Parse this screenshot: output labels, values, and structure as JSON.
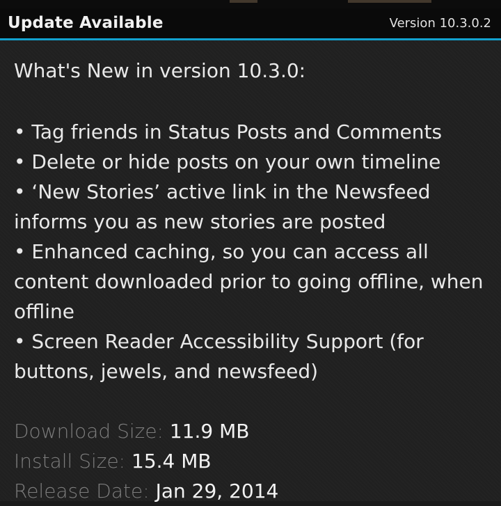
{
  "header": {
    "title": "Update Available",
    "version": "Version 10.3.0.2"
  },
  "release_notes": {
    "heading": "What's New in version 10.3.0:",
    "bullet": "•",
    "items": [
      "Tag friends in Status Posts and Comments",
      "Delete or hide posts on your own timeline",
      "‘New Stories’ active link in the Newsfeed informs you as new stories are posted",
      "Enhanced caching, so you can access all content downloaded prior to going offline, when offline",
      "Screen Reader Accessibility Support (for buttons, jewels, and newsfeed)"
    ]
  },
  "details": {
    "download_size": {
      "label": "Download Size:",
      "value": "11.9 MB"
    },
    "install_size": {
      "label": "Install Size:",
      "value": "15.4 MB"
    },
    "release_date": {
      "label": "Release Date:",
      "value": "Jan 29, 2014"
    }
  },
  "colors": {
    "accent": "#12a2cf",
    "titlebar_bg": "#0a0a0a",
    "content_bg": "#202020",
    "primary_text": "#e9e9e9",
    "label_text": "#7d7d7d"
  }
}
